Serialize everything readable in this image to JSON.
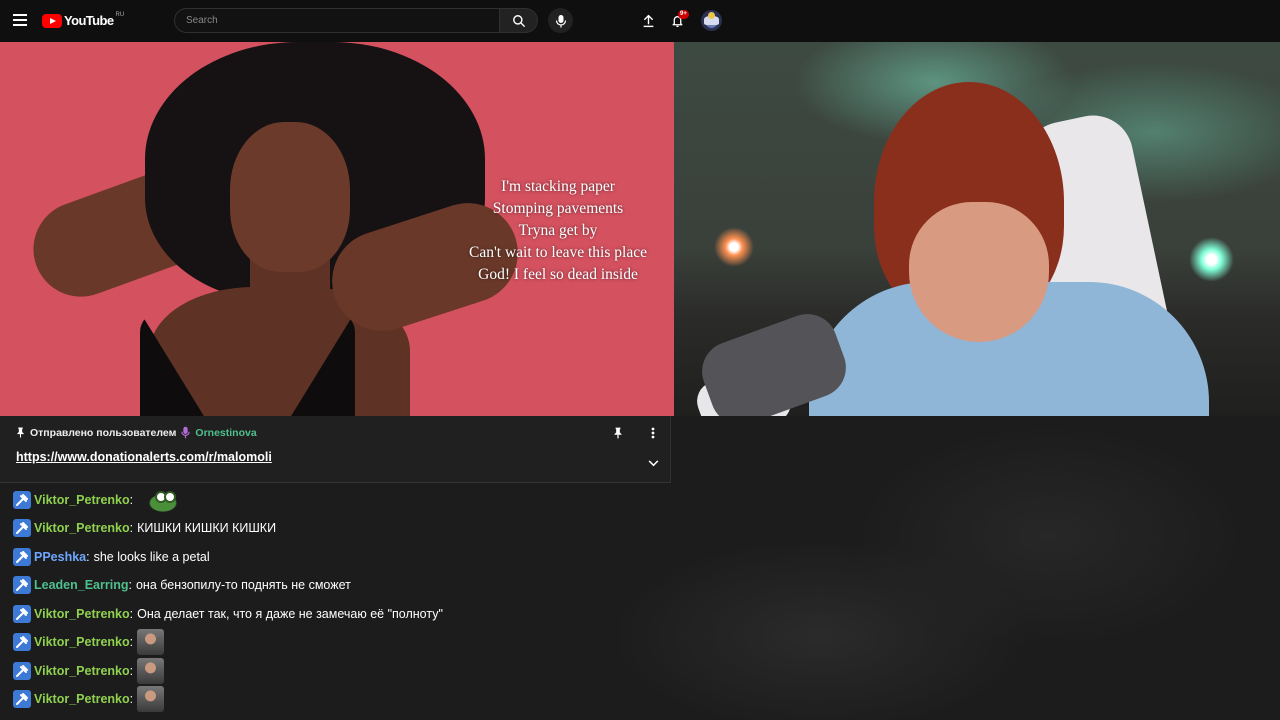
{
  "header": {
    "logo_text": "YouTube",
    "logo_region": "RU",
    "search_placeholder": "Search",
    "notification_count": "9+",
    "icons": {
      "menu": "hamburger-icon",
      "search": "search-icon",
      "mic": "mic-icon",
      "upload": "upload-icon",
      "bell": "bell-icon",
      "avatar": "avatar"
    }
  },
  "video": {
    "lyrics": [
      "I'm stacking paper",
      "Stomping pavements",
      "Tryna get by",
      "Can't wait to leave this place",
      "God! I feel so dead inside"
    ]
  },
  "pinned": {
    "prefix": "Отправлено пользователем",
    "user": "Ornestinova",
    "link": "https://www.donationalerts.com/r/malomoli"
  },
  "chat": {
    "messages": [
      {
        "user": "Viktor_Petrenko",
        "text": "",
        "emote": "frog-emote",
        "user_color": "#8fd14f"
      },
      {
        "user": "Viktor_Petrenko",
        "text": "КИШКИ КИШКИ КИШКИ",
        "emote": "",
        "user_color": "#8fd14f"
      },
      {
        "user": "PPeshka",
        "text": "she looks like a petal",
        "emote": "",
        "user_color": "#6ea7ff"
      },
      {
        "user": "Leaden_Earring",
        "text": "она бензопилу-то поднять не сможет",
        "emote": "",
        "user_color": "#4fc08d"
      },
      {
        "user": "Viktor_Petrenko",
        "text": "Она делает так, что я даже не замечаю её \"полноту\"",
        "emote": "",
        "user_color": "#8fd14f"
      },
      {
        "user": "Viktor_Petrenko",
        "text": "",
        "emote": "man-emote",
        "user_color": "#8fd14f"
      },
      {
        "user": "Viktor_Petrenko",
        "text": "",
        "emote": "man-emote",
        "user_color": "#8fd14f"
      },
      {
        "user": "Viktor_Petrenko",
        "text": "",
        "emote": "man-emote",
        "user_color": "#8fd14f"
      }
    ]
  }
}
